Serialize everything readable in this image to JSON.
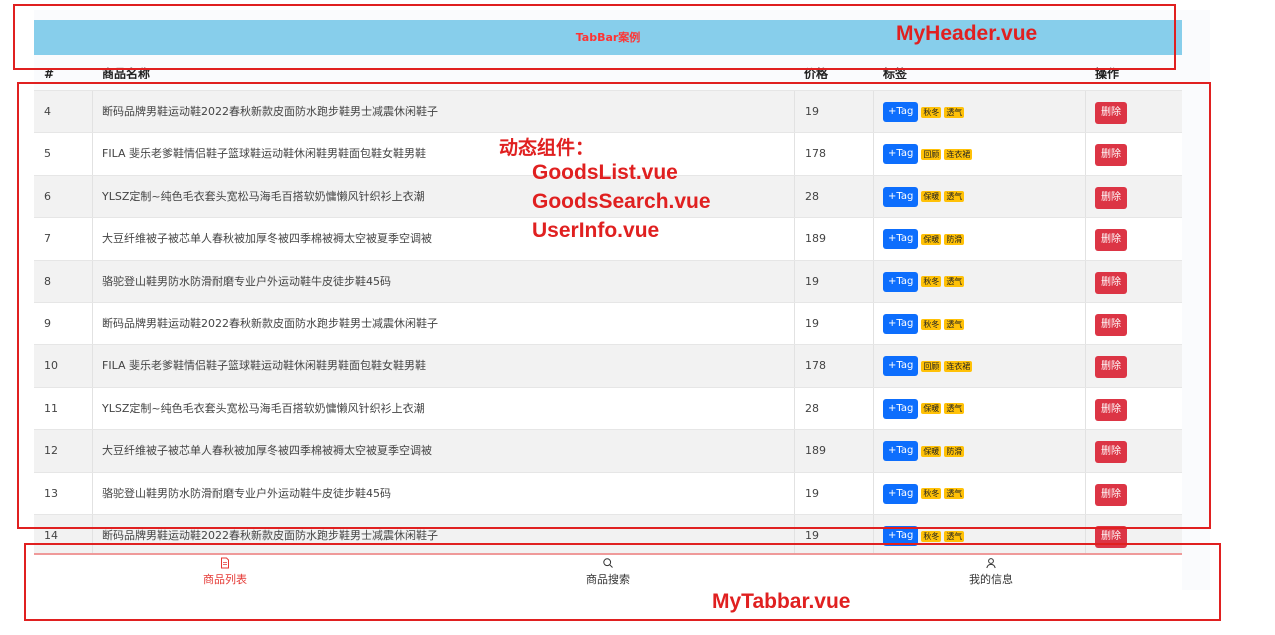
{
  "header": {
    "title": "TabBar案例"
  },
  "table": {
    "columns": [
      "#",
      "商品名称",
      "价格",
      "标签",
      "操作"
    ],
    "tag_button_label": "+Tag",
    "delete_label": "删除",
    "rows": [
      {
        "id": "4",
        "name": "断码品牌男鞋运动鞋2022春秋新款皮面防水跑步鞋男士减震休闲鞋子",
        "price": "19",
        "tags": [
          "秋冬",
          "透气"
        ]
      },
      {
        "id": "5",
        "name": "FILA 斐乐老爹鞋情侣鞋子篮球鞋运动鞋休闲鞋男鞋面包鞋女鞋男鞋",
        "price": "178",
        "tags": [
          "回顾",
          "连衣裙"
        ]
      },
      {
        "id": "6",
        "name": "YLSZ定制~纯色毛衣套头宽松马海毛百搭软奶慵懒风针织衫上衣潮",
        "price": "28",
        "tags": [
          "保暖",
          "透气"
        ]
      },
      {
        "id": "7",
        "name": "大豆纤维被子被芯单人春秋被加厚冬被四季棉被褥太空被夏季空调被",
        "price": "189",
        "tags": [
          "保暖",
          "防滑"
        ]
      },
      {
        "id": "8",
        "name": "骆驼登山鞋男防水防滑耐磨专业户外运动鞋牛皮徒步鞋45码",
        "price": "19",
        "tags": [
          "秋冬",
          "透气"
        ]
      },
      {
        "id": "9",
        "name": "断码品牌男鞋运动鞋2022春秋新款皮面防水跑步鞋男士减震休闲鞋子",
        "price": "19",
        "tags": [
          "秋冬",
          "透气"
        ]
      },
      {
        "id": "10",
        "name": "FILA 斐乐老爹鞋情侣鞋子篮球鞋运动鞋休闲鞋男鞋面包鞋女鞋男鞋",
        "price": "178",
        "tags": [
          "回顾",
          "连衣裙"
        ]
      },
      {
        "id": "11",
        "name": "YLSZ定制~纯色毛衣套头宽松马海毛百搭软奶慵懒风针织衫上衣潮",
        "price": "28",
        "tags": [
          "保暖",
          "透气"
        ]
      },
      {
        "id": "12",
        "name": "大豆纤维被子被芯单人春秋被加厚冬被四季棉被褥太空被夏季空调被",
        "price": "189",
        "tags": [
          "保暖",
          "防滑"
        ]
      },
      {
        "id": "13",
        "name": "骆驼登山鞋男防水防滑耐磨专业户外运动鞋牛皮徒步鞋45码",
        "price": "19",
        "tags": [
          "秋冬",
          "透气"
        ]
      },
      {
        "id": "14",
        "name": "断码品牌男鞋运动鞋2022春秋新款皮面防水跑步鞋男士减震休闲鞋子",
        "price": "19",
        "tags": [
          "秋冬",
          "透气"
        ]
      }
    ]
  },
  "tabbar": {
    "tabs": [
      {
        "label": "商品列表",
        "icon": "document-icon",
        "active": true
      },
      {
        "label": "商品搜索",
        "icon": "search-icon",
        "active": false
      },
      {
        "label": "我的信息",
        "icon": "user-icon",
        "active": false
      }
    ]
  },
  "annotations": {
    "header": "MyHeader.vue",
    "dynamic_title": "动态组件：",
    "dynamic_items": [
      "GoodsList.vue",
      "GoodsSearch.vue",
      "UserInfo.vue"
    ],
    "tabbar": "MyTabbar.vue"
  },
  "colors": {
    "header_bg": "#87ceeb",
    "header_title": "#ff3333",
    "tag_button": "#0d6efd",
    "badge": "#ffc107",
    "delete_button": "#dc3545",
    "active_tab": "#e53935",
    "annotation": "#e02020"
  }
}
